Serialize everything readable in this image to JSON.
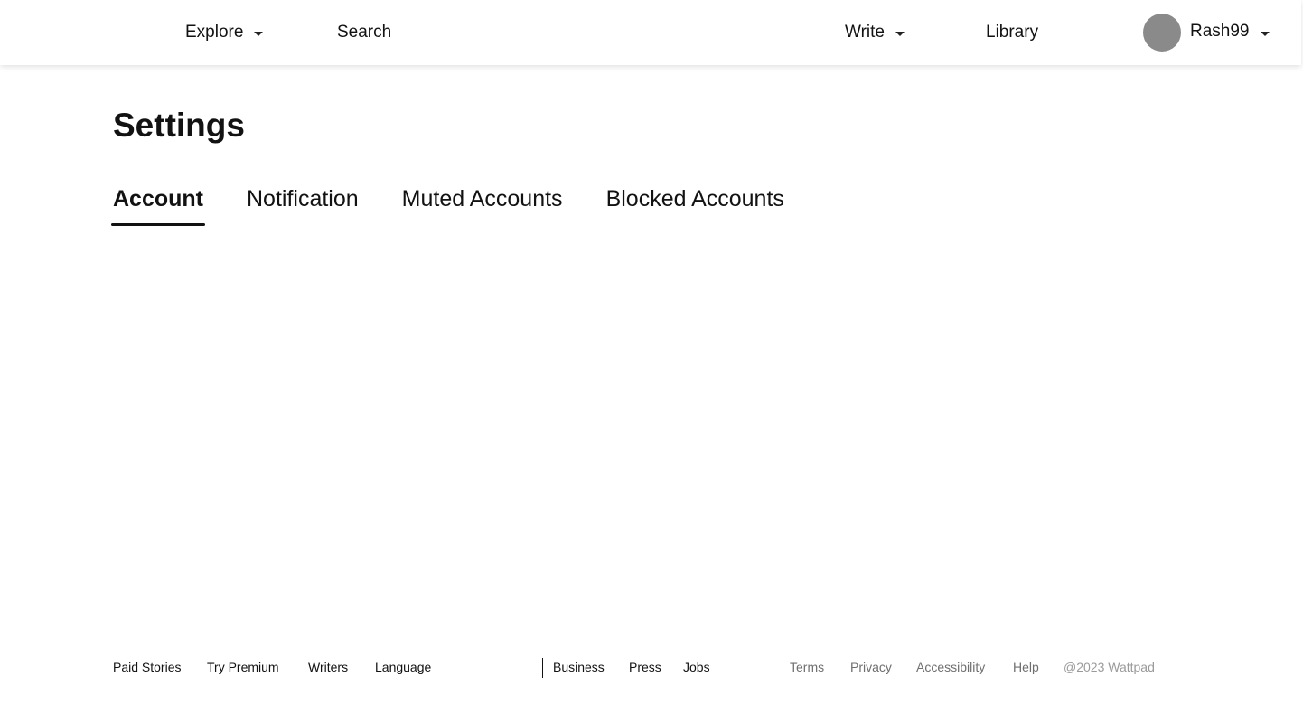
{
  "header": {
    "explore_label": "Explore",
    "search_label": "Search",
    "write_label": "Write",
    "library_label": "Library",
    "username": "Rash99"
  },
  "main": {
    "title": "Settings",
    "tabs": [
      {
        "label": "Account",
        "active": true
      },
      {
        "label": "Notification",
        "active": false
      },
      {
        "label": "Muted Accounts",
        "active": false
      },
      {
        "label": "Blocked Accounts",
        "active": false
      }
    ]
  },
  "footer": {
    "links_left": [
      "Paid Stories",
      "Try Premium",
      "Writers",
      "Language"
    ],
    "links_mid": [
      "Business",
      "Press",
      "Jobs"
    ],
    "links_right": [
      "Terms",
      "Privacy",
      "Accessibility",
      "Help"
    ],
    "copyright": "@2023 Wattpad"
  },
  "colors": {
    "text": "#121212",
    "muted": "#6f6f6f",
    "copyright": "#9a9a9a",
    "avatar": "#8a8a8a"
  },
  "icons": [
    "chevron-down-icon",
    "avatar"
  ]
}
